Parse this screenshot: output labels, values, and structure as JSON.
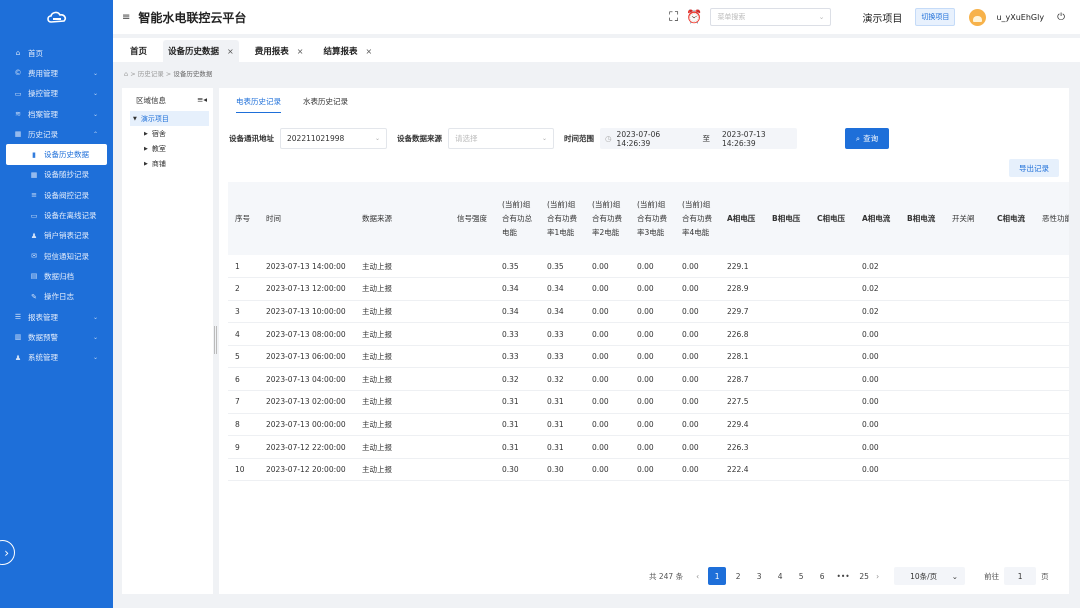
{
  "header": {
    "app_title": "智能水电联控云平台",
    "menu_search_placeholder": "菜单搜索",
    "project_name": "演示项目",
    "switch_project": "切换项目",
    "username": "u_yXuEhGly"
  },
  "sidebar": {
    "items": [
      {
        "label": "首页",
        "icon": "home-icon",
        "glyph": "⌂",
        "caret": ""
      },
      {
        "label": "费用管理",
        "icon": "money-icon",
        "glyph": "©",
        "caret": "⌄"
      },
      {
        "label": "操控管理",
        "icon": "monitor-icon",
        "glyph": "▭",
        "caret": "⌄"
      },
      {
        "label": "档案管理",
        "icon": "layers-icon",
        "glyph": "≋",
        "caret": "⌄"
      },
      {
        "label": "历史记录",
        "icon": "calendar-icon",
        "glyph": "▦",
        "caret": "⌃"
      }
    ],
    "history_sub": [
      {
        "label": "设备历史数据",
        "icon": "bar-chart-icon",
        "glyph": "▮",
        "active": true
      },
      {
        "label": "设备随抄记录",
        "icon": "grid-icon",
        "glyph": "▦"
      },
      {
        "label": "设备阀控记录",
        "icon": "list-icon",
        "glyph": "≡"
      },
      {
        "label": "设备在离线记录",
        "icon": "monitor-icon",
        "glyph": "▭"
      },
      {
        "label": "销户销表记录",
        "icon": "user-icon",
        "glyph": "♟"
      },
      {
        "label": "短信通知记录",
        "icon": "mail-icon",
        "glyph": "✉"
      },
      {
        "label": "数据归档",
        "icon": "archive-icon",
        "glyph": "▤"
      },
      {
        "label": "操作日志",
        "icon": "edit-icon",
        "glyph": "✎"
      }
    ],
    "items_after": [
      {
        "label": "报表管理",
        "icon": "list-icon",
        "glyph": "☰",
        "caret": "⌄"
      },
      {
        "label": "数据预警",
        "icon": "chart-icon",
        "glyph": "▥",
        "caret": "⌄"
      },
      {
        "label": "系统管理",
        "icon": "user-icon",
        "glyph": "♟",
        "caret": "⌄"
      }
    ]
  },
  "tabs": [
    {
      "label": "首页",
      "closable": false
    },
    {
      "label": "设备历史数据",
      "closable": true,
      "active": true
    },
    {
      "label": "费用报表",
      "closable": true
    },
    {
      "label": "结算报表",
      "closable": true
    }
  ],
  "breadcrumb": {
    "a": "历史记录",
    "b": "设备历史数据"
  },
  "tree": {
    "title": "区域信息",
    "root": "演示项目",
    "children": [
      "宿舍",
      "教室",
      "商铺"
    ]
  },
  "sub_tabs": [
    "电表历史记录",
    "水表历史记录"
  ],
  "filters": {
    "addr_label": "设备通讯地址",
    "addr_value": "202211021998",
    "source_label": "设备数据来源",
    "source_placeholder": "请选择",
    "time_label": "时间范围",
    "start": "2023-07-06 14:26:39",
    "to": "至",
    "end": "2023-07-13 14:26:39",
    "query": "查询",
    "export": "导出记录"
  },
  "table": {
    "columns": [
      "序号",
      "时间",
      "数据来源",
      "信号强度",
      "(当前)组合有功总电能",
      "(当前)组合有功费率1电能",
      "(当前)组合有功费率2电能",
      "(当前)组合有功费率3电能",
      "(当前)组合有功费率4电能",
      "A相电压",
      "B相电压",
      "C相电压",
      "A相电流",
      "B相电流",
      "开关闸",
      "C相电流",
      "恶性功能"
    ],
    "rows": [
      [
        "1",
        "2023-07-13 14:00:00",
        "主动上报",
        "",
        "0.35",
        "0.35",
        "0.00",
        "0.00",
        "0.00",
        "229.1",
        "",
        "",
        "0.02",
        "",
        "",
        "",
        ""
      ],
      [
        "2",
        "2023-07-13 12:00:00",
        "主动上报",
        "",
        "0.34",
        "0.34",
        "0.00",
        "0.00",
        "0.00",
        "228.9",
        "",
        "",
        "0.02",
        "",
        "",
        "",
        ""
      ],
      [
        "3",
        "2023-07-13 10:00:00",
        "主动上报",
        "",
        "0.34",
        "0.34",
        "0.00",
        "0.00",
        "0.00",
        "229.7",
        "",
        "",
        "0.02",
        "",
        "",
        "",
        ""
      ],
      [
        "4",
        "2023-07-13 08:00:00",
        "主动上报",
        "",
        "0.33",
        "0.33",
        "0.00",
        "0.00",
        "0.00",
        "226.8",
        "",
        "",
        "0.00",
        "",
        "",
        "",
        ""
      ],
      [
        "5",
        "2023-07-13 06:00:00",
        "主动上报",
        "",
        "0.33",
        "0.33",
        "0.00",
        "0.00",
        "0.00",
        "228.1",
        "",
        "",
        "0.00",
        "",
        "",
        "",
        ""
      ],
      [
        "6",
        "2023-07-13 04:00:00",
        "主动上报",
        "",
        "0.32",
        "0.32",
        "0.00",
        "0.00",
        "0.00",
        "228.7",
        "",
        "",
        "0.00",
        "",
        "",
        "",
        ""
      ],
      [
        "7",
        "2023-07-13 02:00:00",
        "主动上报",
        "",
        "0.31",
        "0.31",
        "0.00",
        "0.00",
        "0.00",
        "227.5",
        "",
        "",
        "0.00",
        "",
        "",
        "",
        ""
      ],
      [
        "8",
        "2023-07-13 00:00:00",
        "主动上报",
        "",
        "0.31",
        "0.31",
        "0.00",
        "0.00",
        "0.00",
        "229.4",
        "",
        "",
        "0.00",
        "",
        "",
        "",
        ""
      ],
      [
        "9",
        "2023-07-12 22:00:00",
        "主动上报",
        "",
        "0.31",
        "0.31",
        "0.00",
        "0.00",
        "0.00",
        "226.3",
        "",
        "",
        "0.00",
        "",
        "",
        "",
        ""
      ],
      [
        "10",
        "2023-07-12 20:00:00",
        "主动上报",
        "",
        "0.30",
        "0.30",
        "0.00",
        "0.00",
        "0.00",
        "222.4",
        "",
        "",
        "0.00",
        "",
        "",
        "",
        ""
      ]
    ]
  },
  "pagination": {
    "total": "共 247 条",
    "pages": [
      "1",
      "2",
      "3",
      "4",
      "5",
      "6",
      "•••",
      "25"
    ],
    "current": "1",
    "page_size": "10条/页",
    "goto_label": "前往",
    "goto_value": "1",
    "page_unit": "页"
  }
}
